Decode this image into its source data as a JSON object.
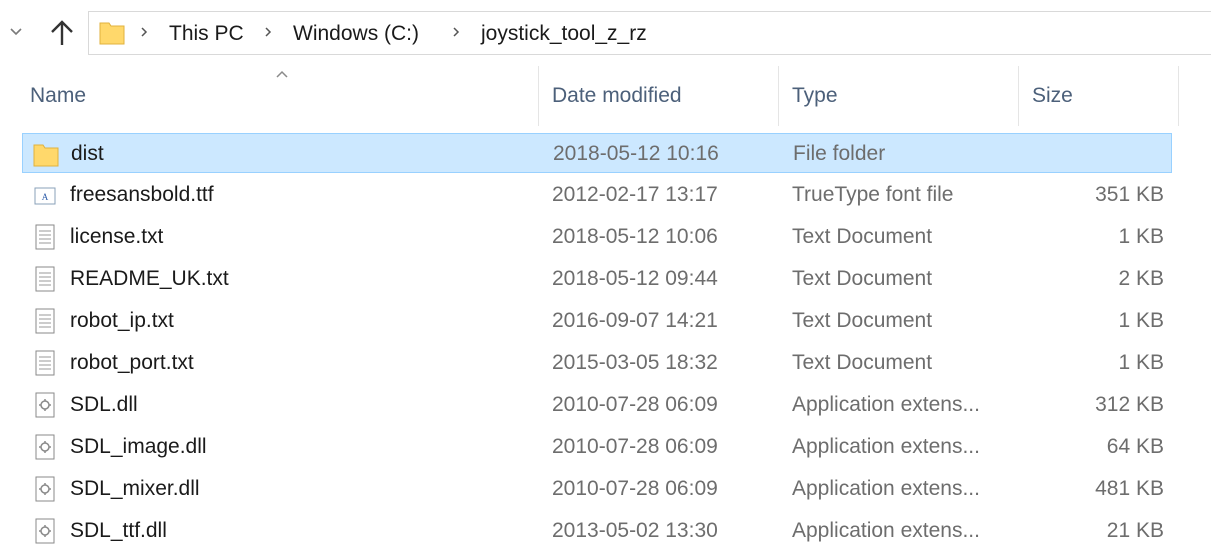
{
  "address_bar": {
    "crumbs": [
      "This PC",
      "Windows (C:)",
      "joystick_tool_z_rz"
    ]
  },
  "columns": {
    "name": "Name",
    "date": "Date modified",
    "type": "Type",
    "size": "Size"
  },
  "files": [
    {
      "name": "dist",
      "date": "2018-05-12 10:16",
      "type": "File folder",
      "size": "",
      "icon": "folder-icon",
      "selected": true
    },
    {
      "name": "freesansbold.ttf",
      "date": "2012-02-17 13:17",
      "type": "TrueType font file",
      "size": "351 KB",
      "icon": "font-file-icon"
    },
    {
      "name": "license.txt",
      "date": "2018-05-12 10:06",
      "type": "Text Document",
      "size": "1 KB",
      "icon": "text-file-icon"
    },
    {
      "name": "README_UK.txt",
      "date": "2018-05-12 09:44",
      "type": "Text Document",
      "size": "2 KB",
      "icon": "text-file-icon"
    },
    {
      "name": "robot_ip.txt",
      "date": "2016-09-07 14:21",
      "type": "Text Document",
      "size": "1 KB",
      "icon": "text-file-icon"
    },
    {
      "name": "robot_port.txt",
      "date": "2015-03-05 18:32",
      "type": "Text Document",
      "size": "1 KB",
      "icon": "text-file-icon"
    },
    {
      "name": "SDL.dll",
      "date": "2010-07-28 06:09",
      "type": "Application extens...",
      "size": "312 KB",
      "icon": "dll-file-icon"
    },
    {
      "name": "SDL_image.dll",
      "date": "2010-07-28 06:09",
      "type": "Application extens...",
      "size": "64 KB",
      "icon": "dll-file-icon"
    },
    {
      "name": "SDL_mixer.dll",
      "date": "2010-07-28 06:09",
      "type": "Application extens...",
      "size": "481 KB",
      "icon": "dll-file-icon"
    },
    {
      "name": "SDL_ttf.dll",
      "date": "2013-05-02 13:30",
      "type": "Application extens...",
      "size": "21 KB",
      "icon": "dll-file-icon"
    }
  ],
  "colors": {
    "selection_bg": "#cce8ff",
    "selection_border": "#99d1ff",
    "header_text": "#4c607a",
    "folder_yellow": "#ffd86b"
  }
}
